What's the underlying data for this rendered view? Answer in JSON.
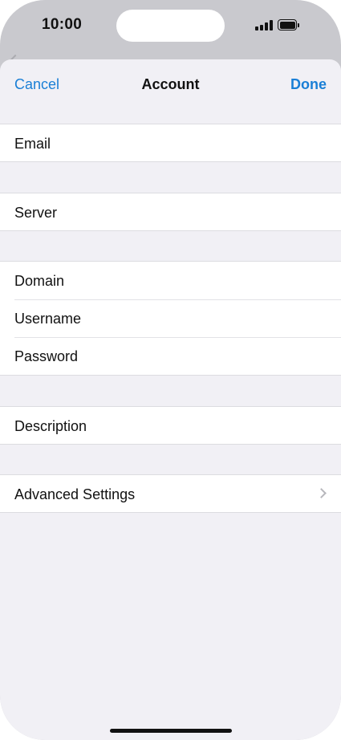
{
  "status_bar": {
    "time": "10:00",
    "icons": [
      "cellular-signal-icon",
      "battery-icon"
    ]
  },
  "nav": {
    "cancel_label": "Cancel",
    "title": "Account",
    "done_label": "Done"
  },
  "form": {
    "email_label": "Email",
    "email_value": "",
    "server_label": "Server",
    "server_value": "",
    "domain_label": "Domain",
    "domain_value": "",
    "username_label": "Username",
    "username_value": "",
    "password_label": "Password",
    "password_value": "",
    "description_label": "Description",
    "description_value": "",
    "advanced_label": "Advanced Settings"
  },
  "colors": {
    "accent": "#1a7fd6",
    "sheet_background": "#f1f0f5",
    "cell_background": "#ffffff"
  }
}
